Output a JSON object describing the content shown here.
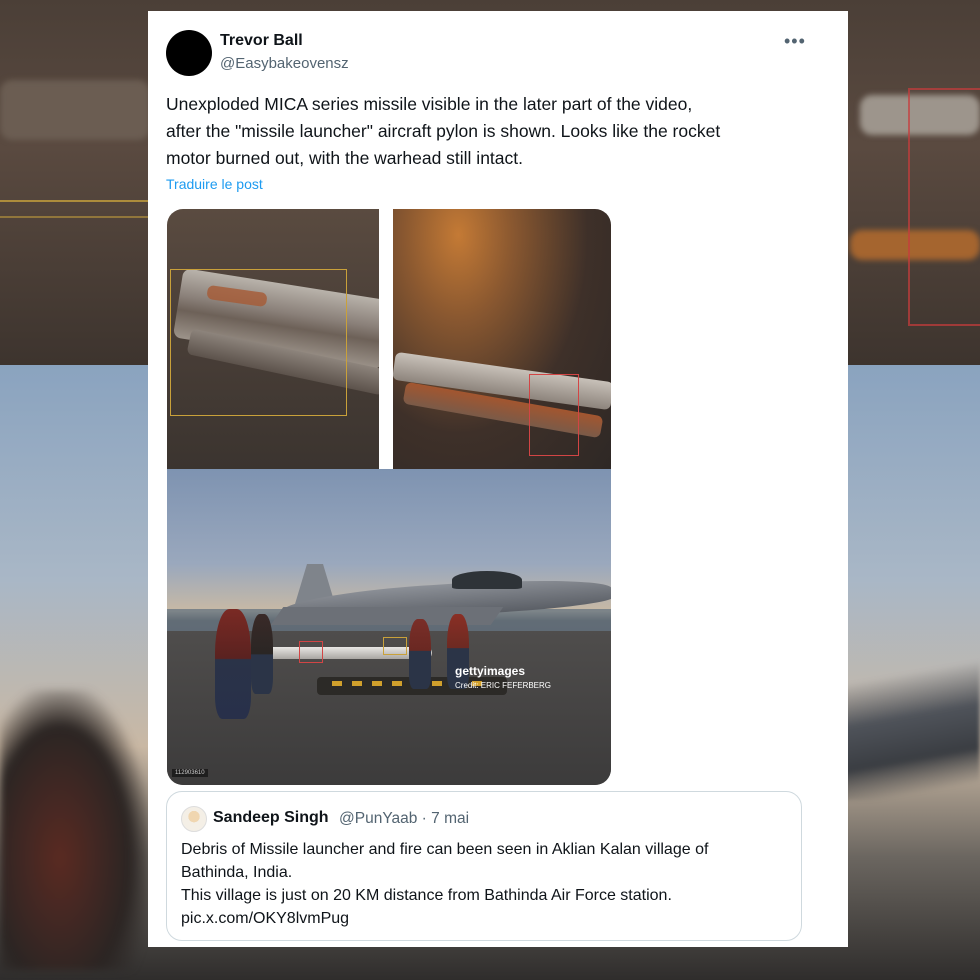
{
  "tweet": {
    "author_name": "Trevor Ball",
    "author_handle": "@Easybakeovensz",
    "more_icon": "more-horizontal-icon",
    "text_lines": [
      "Unexploded MICA series missile visible in the later part of the video,",
      "after the \"missile launcher\" aircraft pylon is shown. Looks like the rocket",
      "motor burned out, with the warhead still intact."
    ],
    "translate_label": "Traduire le post"
  },
  "media": {
    "watermark": "gettyimages",
    "credit": "Credit: ERIC FEFERBERG",
    "image_id": "112903610"
  },
  "quoted": {
    "author_name": "Sandeep Singh",
    "meta": "@PunYaab · 7 mai",
    "text_lines": [
      "Debris of Missile launcher and fire can been  seen in Aklian Kalan village of",
      "Bathinda, India.",
      "This village is just on 20 KM distance from Bathinda Air Force station.",
      "pic.x.com/OKY8lvmPug"
    ]
  },
  "colors": {
    "link": "#1d9bf0",
    "text": "#0f1419",
    "secondary": "#536471",
    "highlight_yellow": "#c9a13a",
    "highlight_red": "#d24545"
  }
}
